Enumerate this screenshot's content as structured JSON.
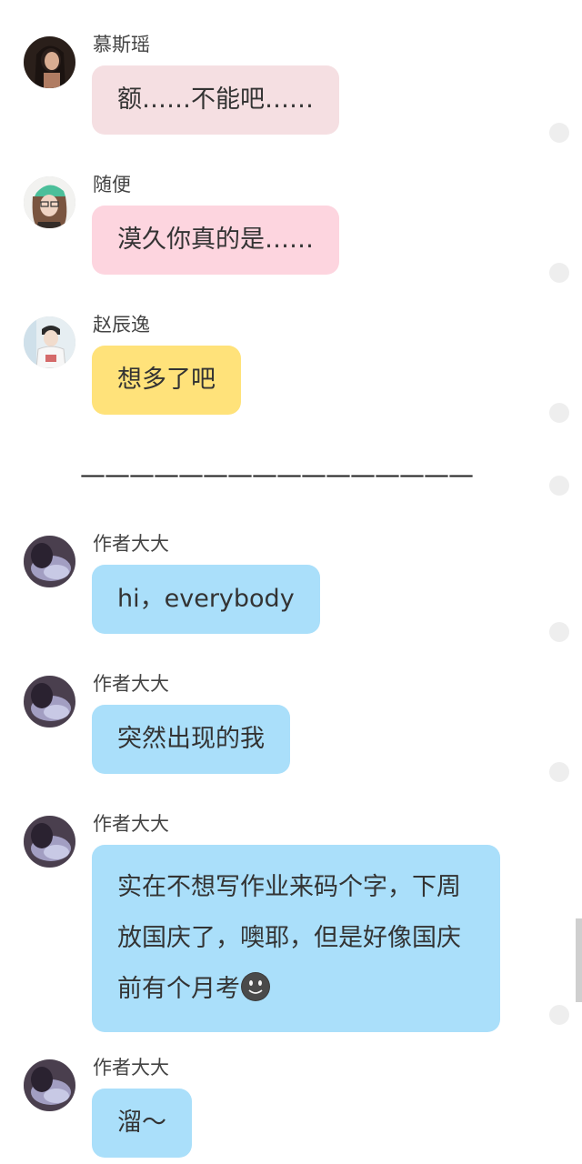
{
  "messages": [
    {
      "sender": "慕斯瑶",
      "text": "额……不能吧……",
      "bubble_color": "#f5dfe2"
    },
    {
      "sender": "随便",
      "text": "漠久你真的是……",
      "bubble_color": "#fdd5df"
    },
    {
      "sender": "赵辰逸",
      "text": "想多了吧",
      "bubble_color": "#ffe27a"
    },
    {
      "sender": "作者大大",
      "text": "hi，everybody",
      "bubble_color": "#aadffa"
    },
    {
      "sender": "作者大大",
      "text": "突然出现的我",
      "bubble_color": "#aadffa"
    },
    {
      "sender": "作者大大",
      "text": "实在不想写作业来码个字，下周放国庆了，噢耶，但是好像国庆前有个月考",
      "emoji": "smirk-face-icon",
      "bubble_color": "#aadffa"
    },
    {
      "sender": "作者大大",
      "text": "溜～",
      "bubble_color": "#aadffa"
    }
  ],
  "divider": "————————————————"
}
